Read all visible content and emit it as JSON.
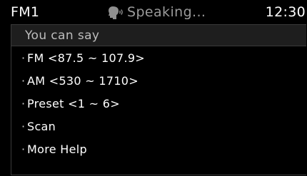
{
  "status_bar": {
    "source": "FM1",
    "voice_status": "Speaking...",
    "voice_icon": "speaking-head-icon",
    "clock": "12:30"
  },
  "prompt_panel": {
    "title": "You can say",
    "options": [
      {
        "bullet": "·",
        "label": "FM <87.5 ~ 107.9>"
      },
      {
        "bullet": "·",
        "label": "AM <530 ~ 1710>"
      },
      {
        "bullet": "·",
        "label": "Preset <1 ~ 6>"
      },
      {
        "bullet": "·",
        "label": "Scan"
      },
      {
        "bullet": "·",
        "label": "More Help"
      }
    ]
  },
  "colors": {
    "background": "#000000",
    "text": "#ffffff",
    "muted_text": "#9a9a9a",
    "header_bg": "#1e1e1e",
    "border": "#3a3a3a"
  }
}
